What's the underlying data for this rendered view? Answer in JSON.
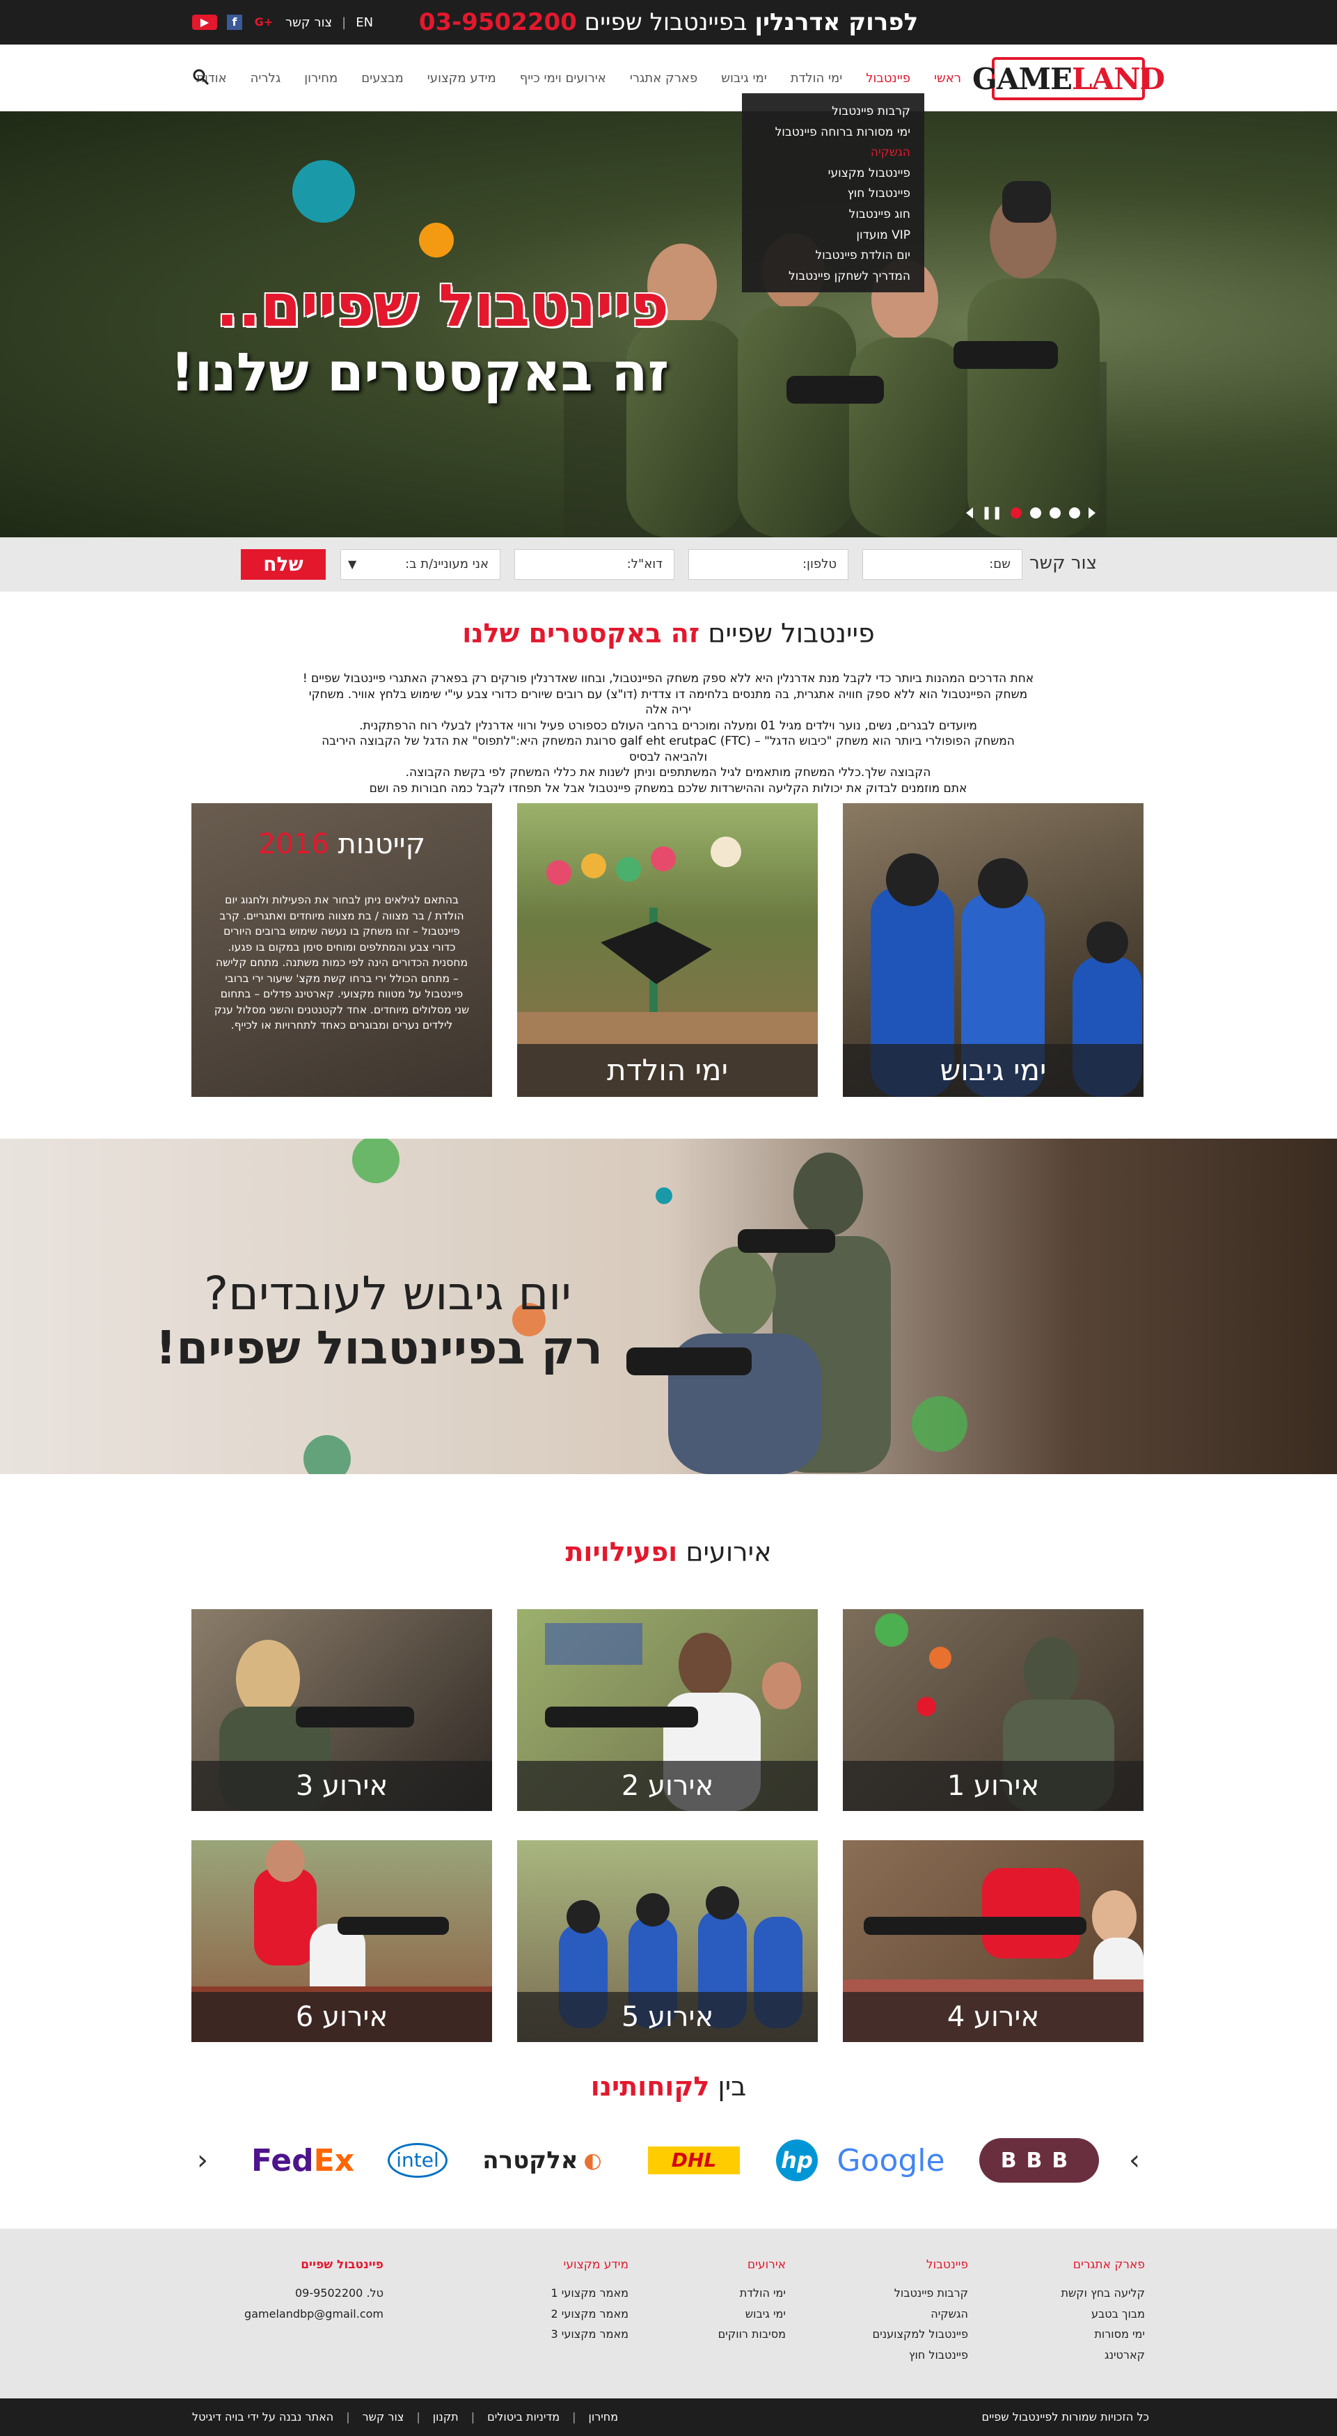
{
  "topbar": {
    "phone_prefix": "לפרוק אדרנלין",
    "phone_mid": "בפיינטבול שפיים",
    "phone_number": "03-9502200",
    "lang": "EN",
    "contact": "צור קשר",
    "social": [
      "youtube-icon",
      "facebook-icon",
      "googleplus-icon"
    ]
  },
  "logo": {
    "brand_game": "GAME",
    "brand_land": "LAND"
  },
  "nav": {
    "items": [
      "ראשי",
      "פיינטבול",
      "ימי הולדת",
      "ימי גיבוש",
      "פארק אתגרי",
      "אירועים וימי כייף",
      "מידע מקצועי",
      "מבצעים",
      "מחירון",
      "גלריה",
      "אודות"
    ]
  },
  "dropdown": {
    "items": [
      "קרבות פיינטבול",
      "ימי מסורות ברוחה פיינטבול",
      "הגשקיה",
      "פיינטבול מקצועי",
      "פיינטבול חוץ",
      "חוג פיינטבול",
      "VIP מועדון",
      "יום הולדת פיינטבול",
      "המדריך לשחקן פיינטבול"
    ]
  },
  "hero": {
    "line1": "פיינטבול שפיים..",
    "line2": "זה באקסטרים שלנו!"
  },
  "contact_form": {
    "label": "צור קשר",
    "name": "שם:",
    "phone": "טלפון:",
    "email": "דוא\"ל:",
    "interest": "אני מעוניינ/ת ב:",
    "send": "שלח"
  },
  "intro": {
    "title_a": "פיינטבול שפיים",
    "title_b": "זה באקסטרים שלנו",
    "lines": [
      "אחת הדרכים המהנות ביותר כדי לקבל מנת אדרנלין היא ללא ספק משחק הפיינטבול, ובחוו שאדרנלין פורקים רק בפארק האתגרי פיינטבול שפיים !",
      "משחק הפיינטבול הוא ללא ספק חוויה אתגרית, בה מתנסים בלחימה דו צדדית (דו\"צ) עם רובים שיורים כדורי צבע עי\"י שימוש בלחץ אוויר. משחקי יריה אלה",
      "מיועדים לבגרים, נשים, נוער וילדים מגיל 01 ומעלה ומוכרים ברחבי העולם כספורט פעיל ורווי אדרנלין לבעלי רוח הרפתקנית.",
      "המשחק הפופולרי ביותר הוא משחק \"כיבוש הדגל\" – (FTC) galf eht erutpaC סרוגת המשחק היא:\"לתפוס\" את הדגל של הקבוצה היריבה ולהביאה לבסיס",
      "הקבוצה שלך.כללי המשחק מותאמים לגיל המשתתפים וניתן לשנות את כללי המשחק לפי בקשת הקבוצה.",
      "אתם מוזמנים לבדוק את יכולות הקליעה וההישרדות שלכם במשחק פיינטבול אבל אל תפחדו לקבל כמה חבורות פה ושם"
    ]
  },
  "cards": {
    "c1": "ימי גיבוש",
    "c2": "ימי הולדת",
    "c3_title": "קייטנות",
    "c3_year": "2016",
    "c3_text": "בהתאם לגילאים ניתן לבחור את הפעילות ולחגוג יום הולדת / בר מצווה / בת מצווה מיוחדים ואתגריים. קרב פיינטבול – זהו משחק בו נעשה שימוש ברובים היורים כדורי צבע והמתלפים ומוחים סימן במקום בו פגעו. מחסנית הכדורים הינה לפי כמות משתנה. מתחם קלישה – מתחם הכולל ירי ברחו קשת מקצ' שיעור ירי ברובי פיינטבול על מטווח מקצועי. קארטינג פדלים – בתחום שני מסלולים מיוחדים. אחד לקטנטנים והשני מסלול ענק לילדים נערים ומבוגרים כאחד לתחרויות או לכייף."
  },
  "banner": {
    "line1": "יום גיבוש לעובדים?",
    "line2": "רק בפיינטבול שפיים!"
  },
  "events_title": {
    "a": "אירועים",
    "b": "ופעילויות"
  },
  "events": [
    "אירוע 1",
    "אירוע 2",
    "אירוע 3",
    "אירוע 4",
    "אירוע 5",
    "אירוע 6"
  ],
  "clients_title": {
    "a": "בין",
    "b": "לקוחותינו"
  },
  "clients": {
    "bbb": "BBB",
    "google": "Google",
    "hp": "hp",
    "dhl": "DHL",
    "electra": "אלקטרה",
    "intel": "intel",
    "fedex_fed": "Fed",
    "fedex_ex": "Ex"
  },
  "footer": {
    "col1": {
      "title": "פארק אתגרים",
      "links": [
        "קליעה בחץ וקשת",
        "מבוך בטבע",
        "ימי מסורות",
        "קארטינג"
      ]
    },
    "col2": {
      "title": "פיינטבול",
      "links": [
        "קרבות פיינטבול",
        "הגשקיה",
        "פיינטבול למקצוענים",
        "פיינטבול חוץ"
      ]
    },
    "col3": {
      "title": "אירועים",
      "links": [
        "ימי הולדת",
        "ימי גיבוש",
        "מסיבות רווקים"
      ]
    },
    "col4": {
      "title": "מידע מקצועי",
      "links": [
        "מאמר מקצועי 1",
        "מאמר מקצועי 2",
        "מאמר מקצועי 3"
      ]
    },
    "col5": {
      "title": "פיינטבול שפיים",
      "phone": "טל. 09-9502200",
      "email": "gamelandbp@gmail.com"
    }
  },
  "bottombar": {
    "copyright": "כל הזכויות שמורות לפיינטבול שפיים",
    "links": [
      "מחירון",
      "מדיניות ביטולים",
      "תקנון",
      "צור קשר",
      "האתר נבנה על ידי בויה דיגיטל"
    ]
  },
  "colors": {
    "accent": "#e3182d",
    "dark": "#1e1e1e"
  }
}
